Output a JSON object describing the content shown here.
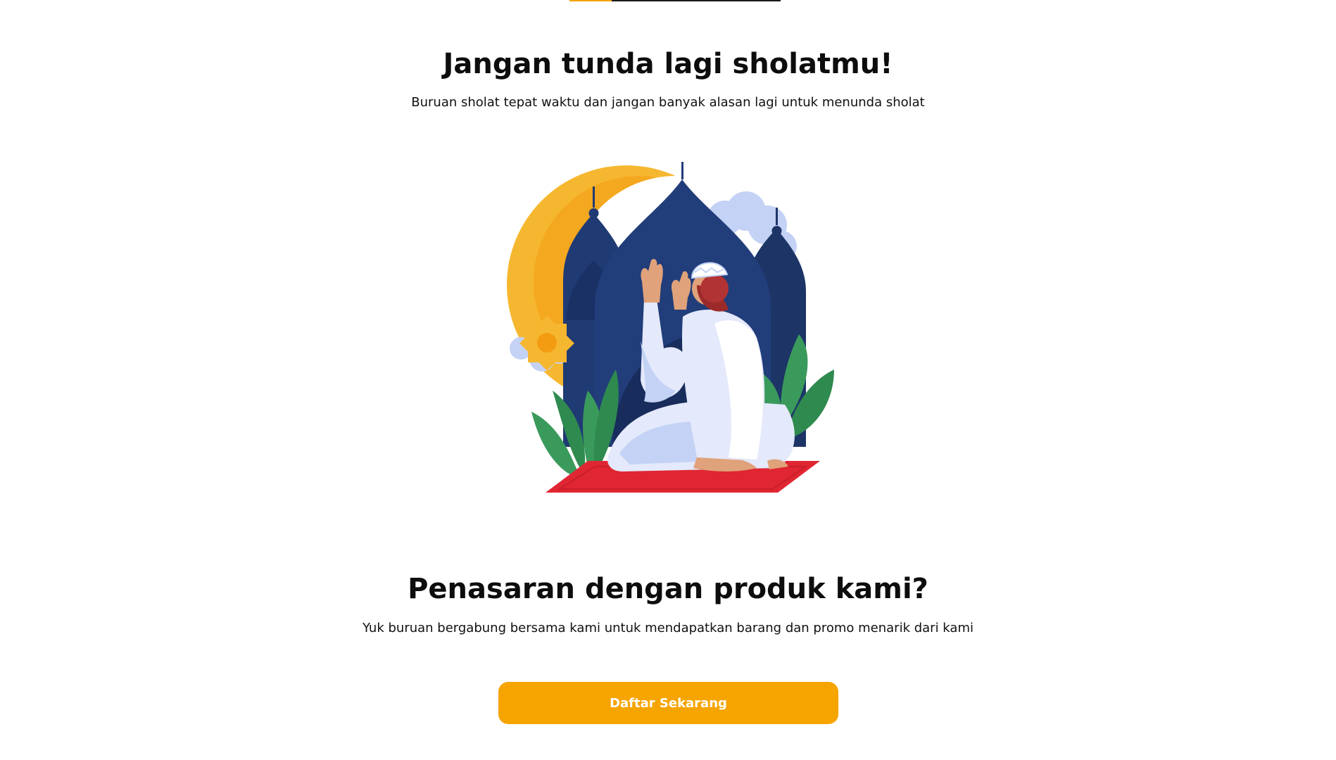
{
  "progress": {
    "fraction": 0.2
  },
  "section_prayer": {
    "title": "Jangan tunda lagi sholatmu!",
    "subtitle": "Buruan sholat tepat waktu dan jangan banyak alasan lagi untuk menunda sholat"
  },
  "section_product": {
    "title": "Penasaran dengan produk kami?",
    "subtitle": "Yuk buruan bergabung bersama kami untuk mendapatkan barang dan promo menarik dari kami",
    "button_label": "Daftar Sekarang"
  },
  "colors": {
    "accent": "#f6a400",
    "mosque": "#1f3a73",
    "crescent": "#f6b730",
    "leaf": "#3a9a5c",
    "mat": "#e02632",
    "robe": "#e4e9fb",
    "cloud": "#c3d2f5"
  },
  "icons": {
    "illustration": "praying-man-mosque-illustration"
  }
}
